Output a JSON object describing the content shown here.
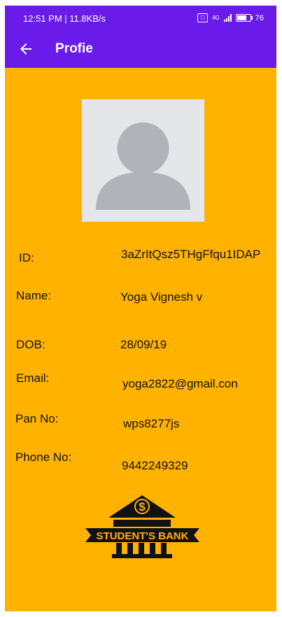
{
  "status_bar": {
    "time_speed": "12:51 PM | 11.8KB/s",
    "network": "4G",
    "battery": "76"
  },
  "app_bar": {
    "title": "Profie",
    "back_icon": "arrow-left-icon"
  },
  "profile": {
    "avatar_icon": "person-placeholder-icon",
    "fields": {
      "id": {
        "label": "ID:",
        "value": "3aZrItQsz5THgFfqu1IDAP"
      },
      "name": {
        "label": "Name:",
        "value": "Yoga Vignesh v"
      },
      "dob": {
        "label": "DOB:",
        "value": "28/09/19"
      },
      "email": {
        "label": "Email:",
        "value": "yoga2822@gmail.con"
      },
      "pan": {
        "label": "Pan No:",
        "value": "wps8277js"
      },
      "phone": {
        "label": "Phone No:",
        "value": "9442249329"
      }
    }
  },
  "logo": {
    "text": "STUDENT'S BANK",
    "symbol": "$"
  },
  "colors": {
    "app_bar": "#6A1BEA",
    "background": "#FFB300",
    "avatar_bg": "#E4E6EA",
    "avatar_fg": "#B0B3B7",
    "text": "#111111"
  }
}
